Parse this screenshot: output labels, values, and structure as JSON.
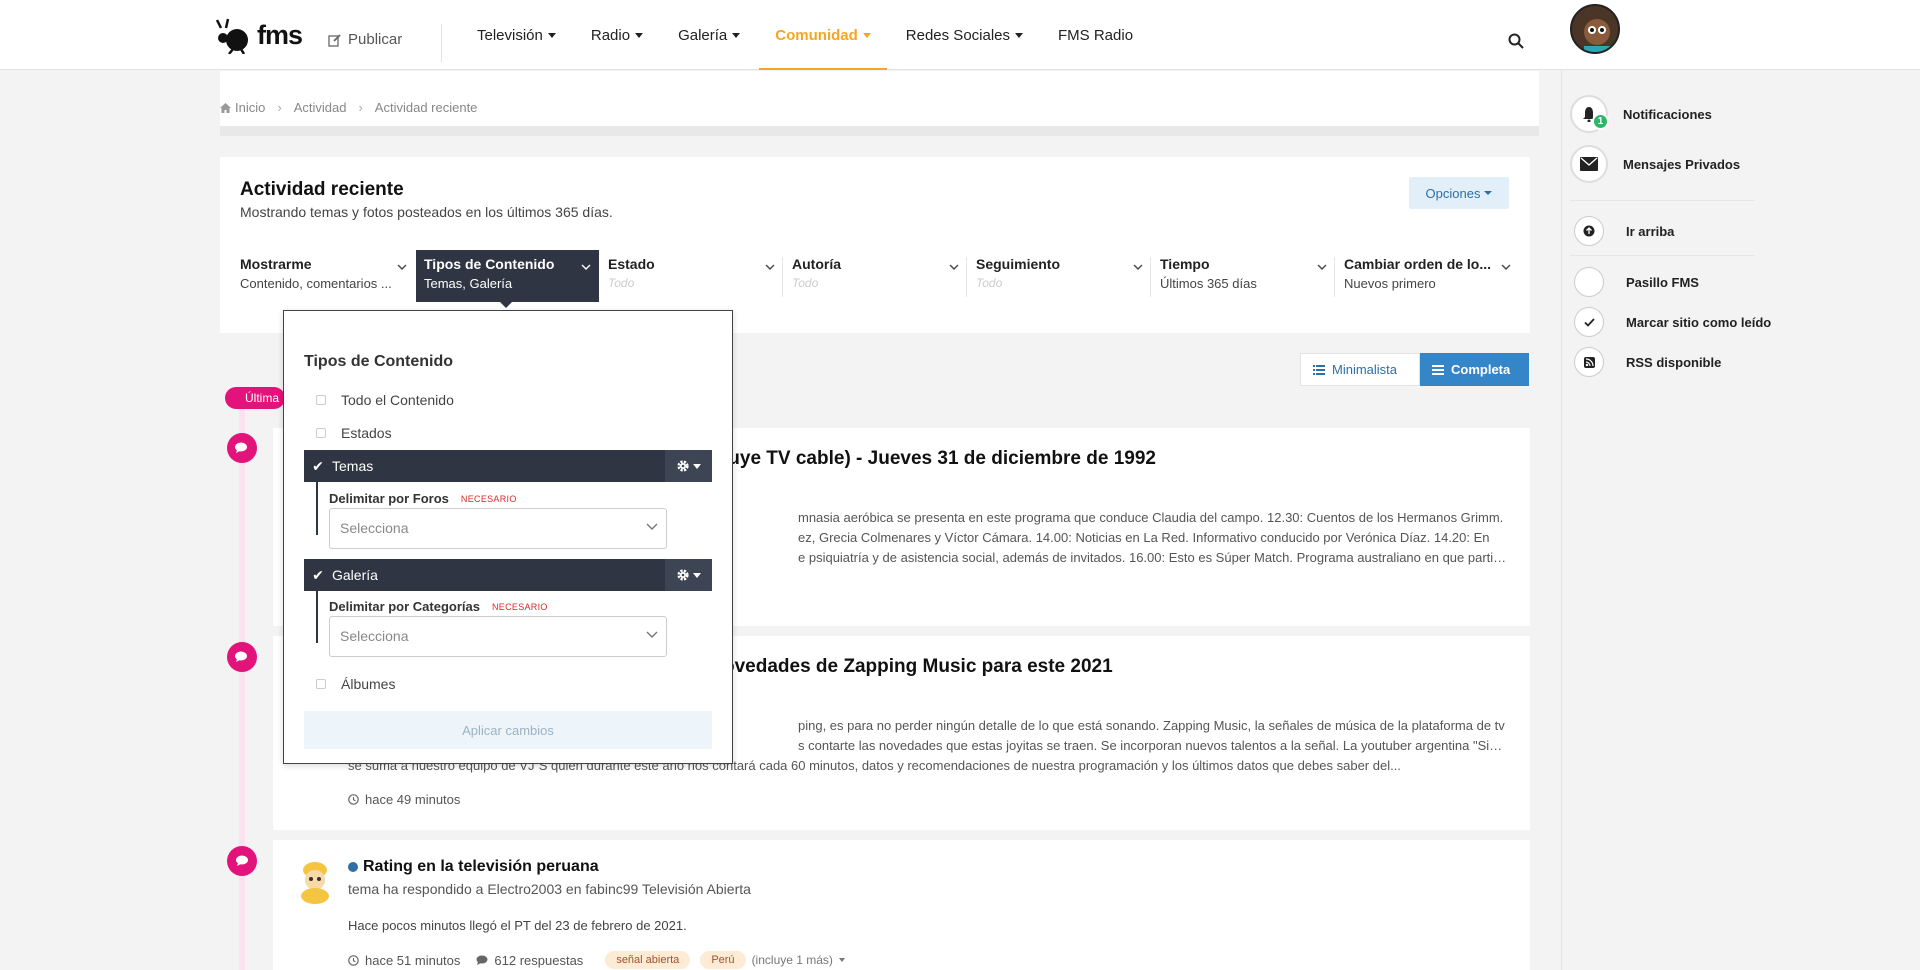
{
  "header": {
    "logo_text": "fms",
    "publish": "Publicar",
    "nav": [
      {
        "label": "Televisión",
        "dropdown": true
      },
      {
        "label": "Radio",
        "dropdown": true
      },
      {
        "label": "Galería",
        "dropdown": true
      },
      {
        "label": "Comunidad",
        "dropdown": true,
        "active": true
      },
      {
        "label": "Redes Sociales",
        "dropdown": true
      },
      {
        "label": "FMS Radio",
        "dropdown": false
      }
    ]
  },
  "sidebar": {
    "notifications": "Notificaciones",
    "notifications_count": "1",
    "messages": "Mensajes Privados",
    "go_top": "Ir arriba",
    "pasillo": "Pasillo FMS",
    "mark_read": "Marcar sitio como leído",
    "rss": "RSS disponible"
  },
  "breadcrumb": [
    "Inicio",
    "Actividad",
    "Actividad reciente"
  ],
  "activity": {
    "title": "Actividad reciente",
    "subtitle": "Mostrando temas y fotos posteados en los últimos 365 días.",
    "options_button": "Opciones",
    "filters": [
      {
        "label": "Mostrarme",
        "value": "Contenido, comentarios ...",
        "empty": false
      },
      {
        "label": "Tipos de Contenido",
        "value": "Temas, Galería",
        "empty": false,
        "active": true
      },
      {
        "label": "Estado",
        "value": "Todo",
        "empty": true
      },
      {
        "label": "Autoría",
        "value": "Todo",
        "empty": true
      },
      {
        "label": "Seguimiento",
        "value": "Todo",
        "empty": true
      },
      {
        "label": "Tiempo",
        "value": "Últimos 365 días",
        "empty": false
      },
      {
        "label": "Cambiar orden de lo...",
        "value": "Nuevos primero",
        "empty": false
      }
    ]
  },
  "view": {
    "minimal": "Minimalista",
    "full": "Completa"
  },
  "timeline_label": "Última",
  "popup": {
    "title": "Tipos de Contenido",
    "all": "Todo el Contenido",
    "estados": "Estados",
    "temas": "Temas",
    "temas_sub": "Delimitar por Foros",
    "galeria": "Galería",
    "galeria_sub": "Delimitar por Categorías",
    "required": "NECESARIO",
    "select_placeholder": "Selecciona",
    "albums": "Álbumes",
    "apply": "Aplicar cambios"
  },
  "items": [
    {
      "title_visible": "luye TV cable) - Jueves 31 de diciembre de 1992",
      "lines": [
        "mnasia aeróbica se presenta en este programa que conduce Claudia del campo. 12.30: Cuentos de los Hermanos Grimm.",
        "ez, Grecia Colmenares y Víctor Cámara. 14.00: Noticias en La Red. Informativo conducido por Verónica Díaz. 14.20: En",
        "e psiquiatría y de asistencia social, además de invitados. 16.00: Esto es Súper Match. Programa australiano en que participan..."
      ]
    },
    {
      "title_visible": "ovedades de Zapping Music para este 2021",
      "lines": [
        "ping, es para no perder ningún detalle de lo que está sonando. Zapping Music, la señales de música de la plataforma de tv",
        "s contarte las novedades que estas joyitas se traen. Se incorporan nuevos talentos a la señal. La youtuber argentina \"Sisofía\"",
        "se suma a nuestro equipo de VJ´S quien durante este año nos contará cada 60 minutos, datos y recomendaciones de nuestra programación y los últimos datos que debes saber del..."
      ],
      "time": "hace 49 minutos"
    },
    {
      "title": "Rating en la televisión peruana",
      "subtitle": "tema ha respondido a Electro2003 en fabinc99 Televisión Abierta",
      "excerpt": "Hace pocos minutos llegó el PT del 23 de febrero de 2021.",
      "time": "hace 51 minutos",
      "replies": "612 respuestas",
      "tags": [
        "señal abierta",
        "Perú"
      ],
      "more": "(incluye 1 más)"
    }
  ]
}
